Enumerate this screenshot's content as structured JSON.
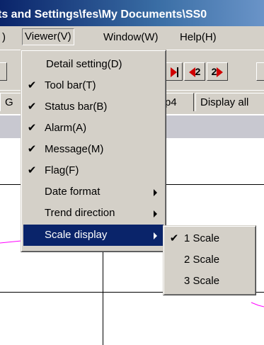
{
  "window": {
    "title": "ts and Settings\\fes\\My Documents\\SS0"
  },
  "menubar": {
    "items": [
      {
        "label": ")"
      },
      {
        "label": "Viewer(V)"
      },
      {
        "label": "Window(W)"
      },
      {
        "label": "Help(H)"
      }
    ]
  },
  "toolbar": {
    "btn_k2": "2",
    "btn_2k": "2"
  },
  "tabs": [
    {
      "label": "G"
    },
    {
      "label": "p4"
    },
    {
      "label": "Display all"
    }
  ],
  "viewer_menu": {
    "items": [
      {
        "label": "Detail setting(D)",
        "checked": false
      },
      {
        "label": "Tool bar(T)",
        "checked": true
      },
      {
        "label": "Status bar(B)",
        "checked": true
      },
      {
        "label": "Alarm(A)",
        "checked": true
      },
      {
        "label": "Message(M)",
        "checked": true
      },
      {
        "label": "Flag(F)",
        "checked": true
      },
      {
        "label": "Date format",
        "submenu": true
      },
      {
        "label": "Trend direction",
        "submenu": true
      },
      {
        "label": "Scale display",
        "submenu": true,
        "highlighted": true
      }
    ],
    "check_glyph": "✔"
  },
  "scale_submenu": {
    "items": [
      {
        "label": "1 Scale",
        "checked": true
      },
      {
        "label": "2 Scale",
        "checked": false
      },
      {
        "label": "3 Scale",
        "checked": false
      }
    ]
  },
  "colors": {
    "title_bar": "#0a246a",
    "menu_bg": "#d4d0c8",
    "highlight": "#0a246a",
    "trend_line": "#ff00ff",
    "button_red": "#d00000",
    "button_green": "#008000"
  }
}
